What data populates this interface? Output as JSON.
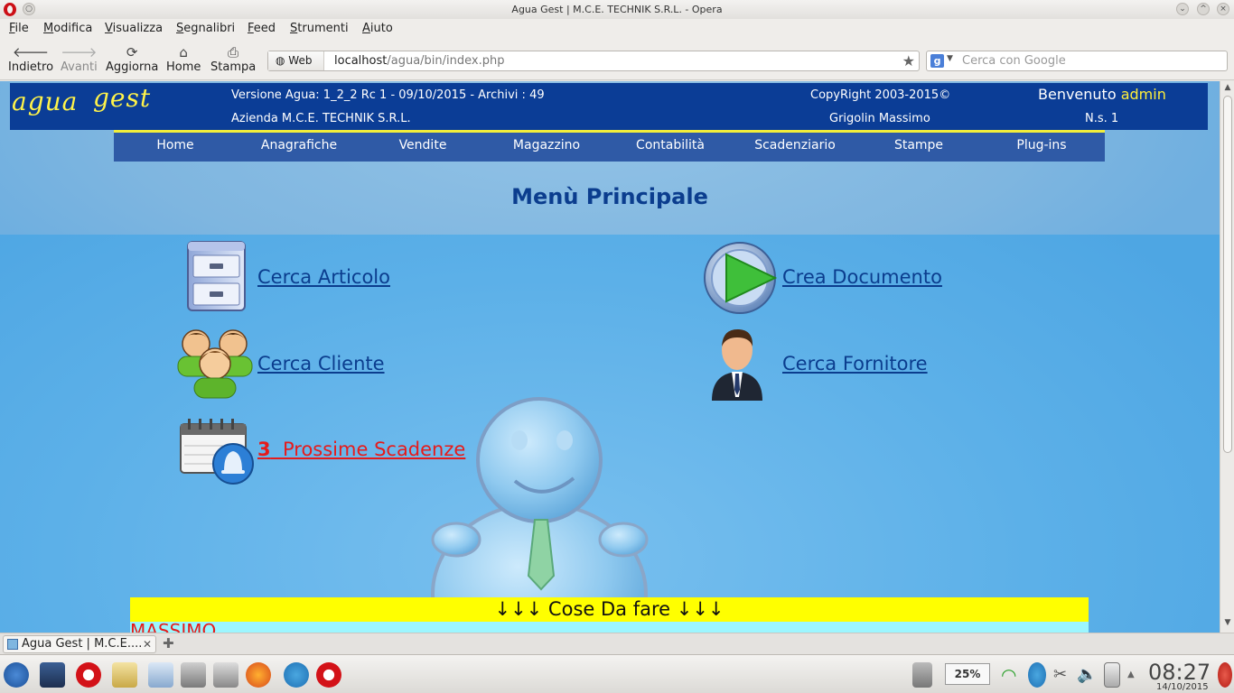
{
  "window": {
    "title": "Agua Gest | M.C.E. TECHNIK S.R.L. - Opera"
  },
  "menubar": [
    "File",
    "Modifica",
    "Visualizza",
    "Segnalibri",
    "Feed",
    "Strumenti",
    "Aiuto"
  ],
  "toolbar": {
    "back": "Indietro",
    "forward": "Avanti",
    "reload": "Aggiorna",
    "home": "Home",
    "print": "Stampa"
  },
  "address": {
    "mode": "Web",
    "url_host": "localhost",
    "url_path": "/agua/bin/index.php"
  },
  "search": {
    "placeholder": "Cerca con Google",
    "engine": "g"
  },
  "header": {
    "logo_a": "agua",
    "logo_b": "gest",
    "version": "Versione Agua: 1_2_2 Rc 1 - 09/10/2015 - Archivi : 49",
    "company": "Azienda M.C.E. TECHNIK S.R.L.",
    "copyright": "CopyRight 2003-2015©",
    "author": "Grigolin Massimo",
    "welcome": "Benvenuto",
    "user": "admin",
    "ns": "N.s. 1"
  },
  "nav": [
    "Home",
    "Anagrafiche",
    "Vendite",
    "Magazzino",
    "Contabilità",
    "Scadenziario",
    "Stampe",
    "Plug-ins"
  ],
  "main": {
    "title": "Menù Principale",
    "links": {
      "cerca_articolo": "Cerca Articolo",
      "crea_documento": "Crea Documento",
      "cerca_cliente": "Cerca Cliente",
      "cerca_fornitore": "Cerca Fornitore",
      "scadenze_count": "3",
      "scadenze_label": "Prossime Scadenze"
    }
  },
  "todo": {
    "header": "↓↓↓ Cose Da fare ↓↓↓",
    "first_item": "MASSIMO"
  },
  "tabs": [
    {
      "label": "Agua Gest | M.C.E...."
    }
  ],
  "taskbar": {
    "battery": "25%",
    "time": "08:27",
    "date": "14/10/2015"
  },
  "colors": {
    "header_bg": "#0b3d96",
    "nav_bg": "#2f5aa6",
    "accent_yellow": "#ffef3a",
    "link_blue": "#0b3d8e",
    "alert_red": "#e61b1b",
    "todo_bar": "#ffff00"
  }
}
